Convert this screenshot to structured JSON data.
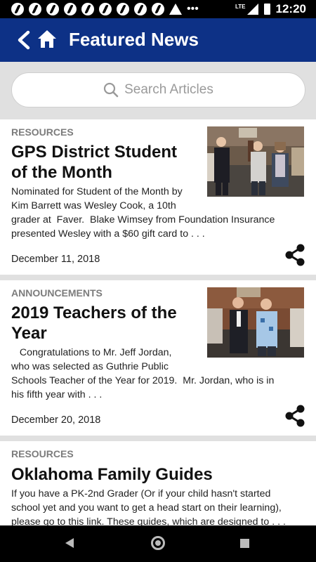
{
  "status_bar": {
    "time": "12:20",
    "network": "LTE",
    "icons": [
      "notification-icon",
      "notification-icon",
      "notification-icon",
      "notification-icon",
      "notification-icon",
      "notification-icon",
      "notification-icon",
      "notification-icon",
      "notification-icon",
      "warning-icon",
      "more-icon",
      "signal-icon",
      "battery-icon"
    ]
  },
  "header": {
    "title": "Featured News",
    "back_icon": "chevron-left-icon",
    "home_icon": "home-icon",
    "color": "#0d3186"
  },
  "search": {
    "placeholder": "Search Articles",
    "icon": "search-icon"
  },
  "articles": [
    {
      "category": "RESOURCES",
      "title_lines": [
        "GPS District Student",
        "of the Month"
      ],
      "excerpt_lines": [
        "Nominated for Student of the Month by",
        "Kim Barrett was Wesley Cook, a 10th",
        "grader at  Faver.  Blake Wimsey from Foundation Insurance",
        "presented Wesley with a $60 gift card to . . ."
      ],
      "date": "December 11, 2018",
      "share_icon": "share-icon"
    },
    {
      "category": "ANNOUNCEMENTS",
      "title_lines": [
        "2019 Teachers of the",
        "Year"
      ],
      "excerpt_lines": [
        "   Congratulations to Mr. Jeff Jordan,",
        "who was selected as Guthrie Public",
        "Schools Teacher of the Year for 2019.  Mr. Jordan, who is in",
        "his fifth year with . . ."
      ],
      "date": "December 20, 2018",
      "share_icon": "share-icon"
    },
    {
      "category": "RESOURCES",
      "title_lines": [
        "Oklahoma Family Guides"
      ],
      "excerpt_lines": [
        "If you have a PK-2nd Grader (Or if your child hasn't started",
        "school yet and you want to get a head start on their learning),",
        "please go to this link. These guides, which are designed to . . ."
      ]
    }
  ],
  "nav_bar": {
    "icons": [
      "back-icon",
      "home-icon",
      "recents-icon"
    ]
  }
}
